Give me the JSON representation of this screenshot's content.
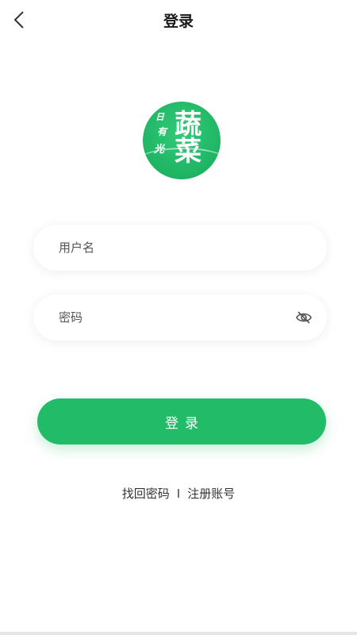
{
  "header": {
    "title": "登录"
  },
  "logo": {
    "chars_left": [
      "日",
      "有",
      "光"
    ],
    "chars_right": [
      "蔬",
      "菜"
    ]
  },
  "form": {
    "username_placeholder": "用户名",
    "password_placeholder": "密码",
    "submit_label": "登录"
  },
  "links": {
    "forgot_password": "找回密码",
    "separator": "I",
    "register": "注册账号"
  },
  "colors": {
    "accent": "#22bb68",
    "background": "#ffffff"
  },
  "icons": {
    "back": "chevron-left-icon",
    "password_toggle": "eye-off-icon"
  }
}
